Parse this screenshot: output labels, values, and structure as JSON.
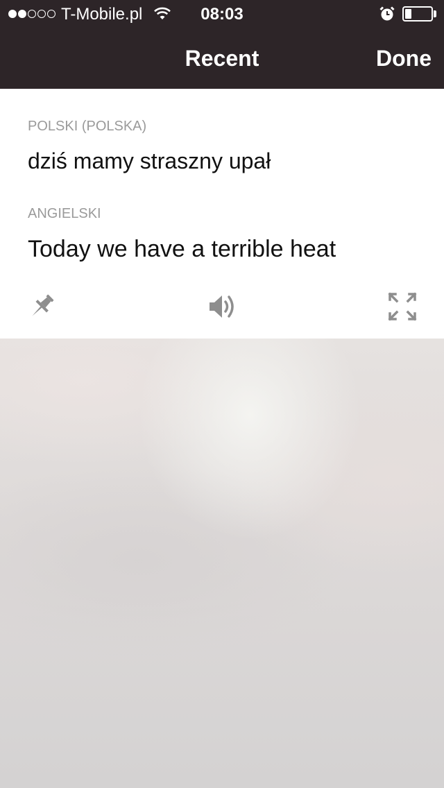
{
  "status_bar": {
    "carrier": "T-Mobile.pl",
    "time": "08:03",
    "signal_bars_filled": 2,
    "signal_bars_total": 5,
    "battery_level": 0.25
  },
  "nav": {
    "title": "Recent",
    "done_label": "Done"
  },
  "translation": {
    "source_language": "POLSKI (POLSKA)",
    "source_text": "dziś mamy straszny upał",
    "target_language": "ANGIELSKI",
    "target_text": "Today we have a terrible heat"
  },
  "actions": {
    "pin_icon": "pin-icon",
    "speaker_icon": "speaker-icon",
    "expand_icon": "expand-icon"
  },
  "colors": {
    "nav_background": "#2d2528",
    "label_gray": "#9a9a9a",
    "icon_gray": "#8e8e8e"
  }
}
